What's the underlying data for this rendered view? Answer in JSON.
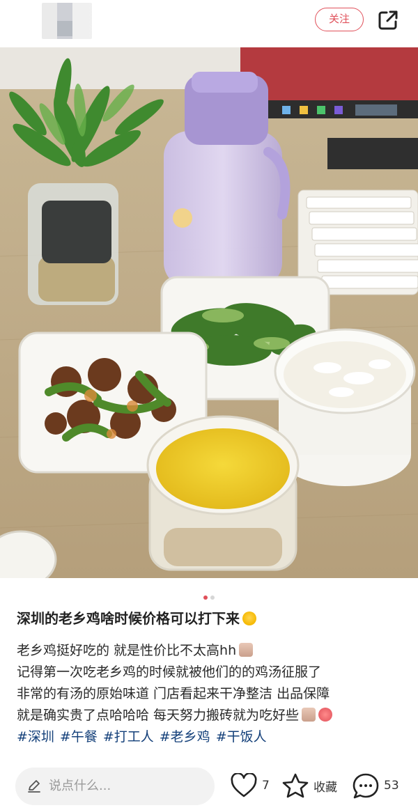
{
  "header": {
    "follow_label": "关注"
  },
  "pager": {
    "count": 2,
    "active": 1
  },
  "post": {
    "title": "深圳的老乡鸡啥时候价格可以打下来",
    "lines": [
      "老乡鸡挺好吃的 就是性价比不太高hh",
      "记得第一次吃老乡鸡的时候就被他们的的鸡汤征服了",
      "非常的有汤的原始味道 门店看起来干净整洁 出品保障",
      "就是确实贵了点哈哈哈 每天努力搬砖就为吃好些"
    ],
    "tags": [
      "#深圳",
      "#午餐",
      "#打工人",
      "#老乡鸡",
      "#干饭人"
    ]
  },
  "bottom_bar": {
    "comment_placeholder": "说点什么...",
    "likes": "7",
    "collect_label": "收藏",
    "comments": "53"
  },
  "colors": {
    "accent": "#e0505a",
    "tag": "#14407a"
  },
  "icons": [
    "share-icon",
    "pencil-icon",
    "heart-icon",
    "star-icon",
    "comment-icon"
  ]
}
